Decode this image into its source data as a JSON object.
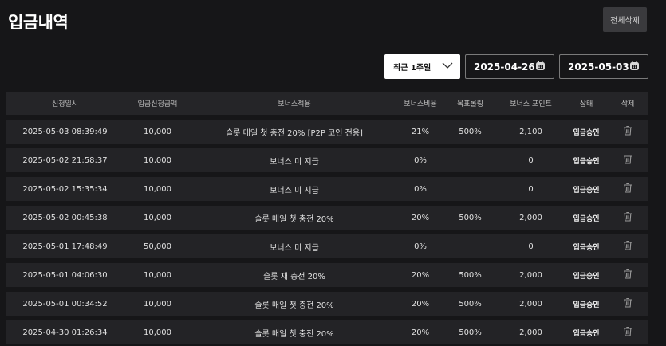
{
  "header": {
    "title": "입금내역",
    "delete_all_label": "전체삭제"
  },
  "filters": {
    "period_label": "최근 1주일",
    "start_date": "2025-04-26",
    "end_date": "2025-05-03"
  },
  "table": {
    "columns": [
      "신청일시",
      "입금신청금액",
      "보너스적용",
      "보너스비율",
      "목표롤링",
      "보너스 포인트",
      "상태",
      "삭제"
    ],
    "rows": [
      {
        "date": "2025-05-03 08:39:49",
        "amount": "10,000",
        "bonus": "슬롯 매일 첫 충전 20% [P2P 코인 전용]",
        "ratio": "21%",
        "rolling": "500%",
        "points": "2,100",
        "status": "입금승인"
      },
      {
        "date": "2025-05-02 21:58:37",
        "amount": "10,000",
        "bonus": "보너스 미 지급",
        "ratio": "0%",
        "rolling": "",
        "points": "0",
        "status": "입금승인"
      },
      {
        "date": "2025-05-02 15:35:34",
        "amount": "10,000",
        "bonus": "보너스 미 지급",
        "ratio": "0%",
        "rolling": "",
        "points": "0",
        "status": "입금승인"
      },
      {
        "date": "2025-05-02 00:45:38",
        "amount": "10,000",
        "bonus": "슬롯 매일 첫 충전 20%",
        "ratio": "20%",
        "rolling": "500%",
        "points": "2,000",
        "status": "입금승인"
      },
      {
        "date": "2025-05-01 17:48:49",
        "amount": "50,000",
        "bonus": "보너스 미 지급",
        "ratio": "0%",
        "rolling": "",
        "points": "0",
        "status": "입금승인"
      },
      {
        "date": "2025-05-01 04:06:30",
        "amount": "10,000",
        "bonus": "슬롯 재 충전 20%",
        "ratio": "20%",
        "rolling": "500%",
        "points": "2,000",
        "status": "입금승인"
      },
      {
        "date": "2025-05-01 00:34:52",
        "amount": "10,000",
        "bonus": "슬롯 매일 첫 충전 20%",
        "ratio": "20%",
        "rolling": "500%",
        "points": "2,000",
        "status": "입금승인"
      },
      {
        "date": "2025-04-30 01:26:34",
        "amount": "10,000",
        "bonus": "슬롯 매일 첫 충전 20%",
        "ratio": "20%",
        "rolling": "500%",
        "points": "2,000",
        "status": "입금승인"
      }
    ]
  },
  "icons": {
    "period_dropdown": "chevron-down-icon",
    "date_picker": "calendar-icon",
    "delete_row": "trash-icon"
  },
  "colors": {
    "background": "#161618",
    "row": "#232326",
    "header_row": "#252528",
    "text": "#e0e0e0"
  }
}
